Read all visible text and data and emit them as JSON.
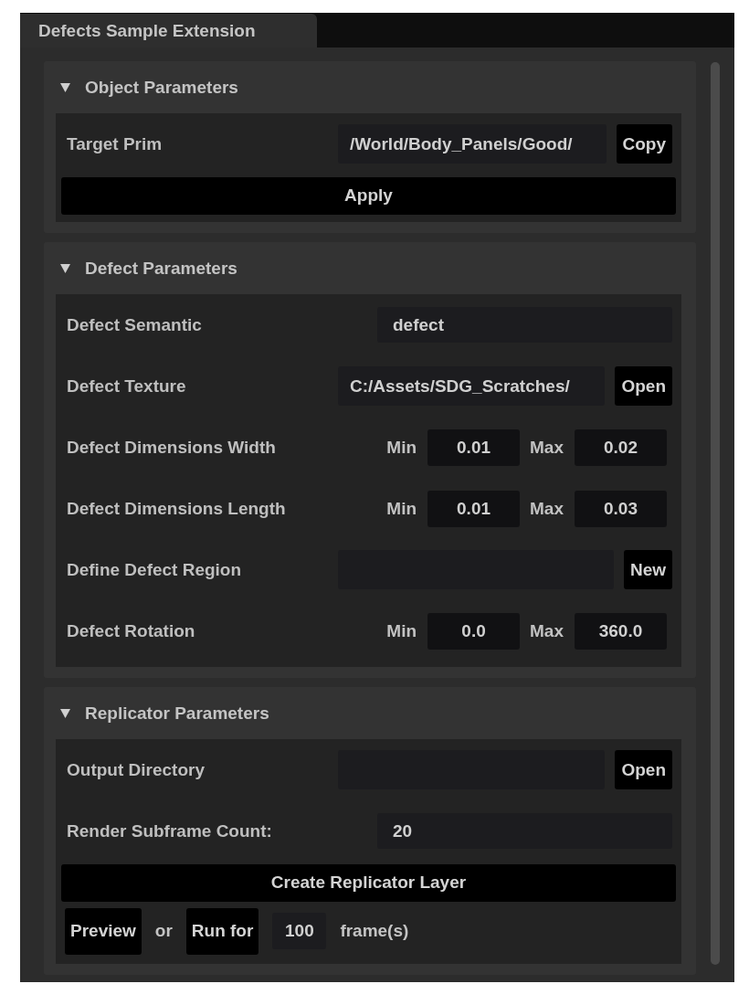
{
  "tab": {
    "title": "Defects Sample Extension",
    "selected": true
  },
  "sections": [
    {
      "title": "Object Parameters",
      "expanded": true,
      "rows": [
        {
          "kind": "path",
          "label": "Target Prim",
          "value": "/World/Body_Panels/Good/",
          "button": "Copy"
        },
        {
          "kind": "button",
          "button": "Apply"
        }
      ]
    },
    {
      "title": "Defect Parameters",
      "expanded": true,
      "rows": [
        {
          "kind": "text",
          "label": "Defect Semantic",
          "value": "defect"
        },
        {
          "kind": "path",
          "label": "Defect Texture",
          "value": "C:/Assets/SDG_Scratches/",
          "button": "Open"
        },
        {
          "kind": "range",
          "label": "Defect Dimensions Width",
          "min_label": "Min",
          "min": "0.01",
          "max_label": "Max",
          "max": "0.02"
        },
        {
          "kind": "range",
          "label": "Defect Dimensions Length",
          "min_label": "Min",
          "min": "0.01",
          "max_label": "Max",
          "max": "0.03"
        },
        {
          "kind": "path",
          "label": "Define Defect Region",
          "button": "New"
        },
        {
          "kind": "range",
          "label": "Defect Rotation",
          "min_label": "Min",
          "min": "0.0",
          "max_label": "Max",
          "max": "360.0"
        }
      ]
    },
    {
      "title": "Replicator Parameters",
      "expanded": true,
      "rows": [
        {
          "kind": "path",
          "label": "Output Directory",
          "button": "Open"
        },
        {
          "kind": "text",
          "label": "Render Subframe Count:",
          "value": "20"
        },
        {
          "kind": "button",
          "button": "Create Replicator Layer"
        },
        {
          "kind": "controls",
          "items": [
            {
              "kind": "button",
              "text": "Preview"
            },
            {
              "kind": "text",
              "text": "or"
            },
            {
              "kind": "button",
              "text": "Run for"
            },
            {
              "kind": "field",
              "text": "100"
            },
            {
              "kind": "text",
              "text": "frame(s)"
            }
          ]
        }
      ]
    }
  ]
}
